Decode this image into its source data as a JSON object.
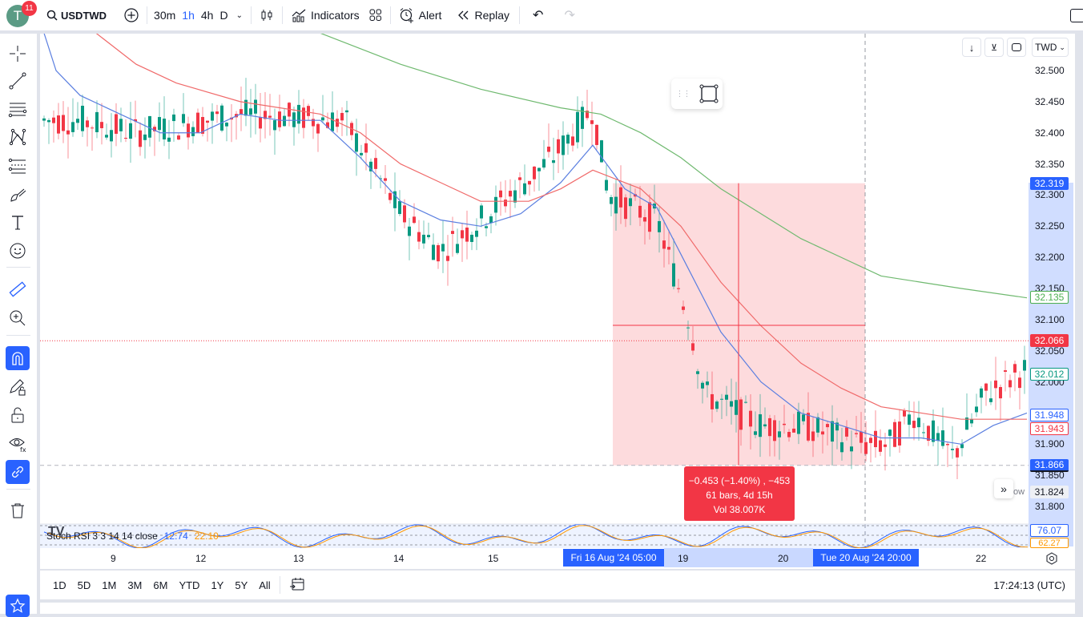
{
  "toolbar": {
    "avatar_letter": "T",
    "notification_count": "11",
    "symbol": "USDTWD",
    "intervals": [
      "30m",
      "1h",
      "4h",
      "D"
    ],
    "active_interval": "1h",
    "indicators_label": "Indicators",
    "alert_label": "Alert",
    "replay_label": "Replay"
  },
  "left_tools": [
    "crosshair",
    "trend-line",
    "horizontal-lines",
    "pattern",
    "fib",
    "brush",
    "text",
    "emoji",
    "ruler",
    "zoom-in",
    "magnet",
    "lock-drawing",
    "lock",
    "visibility",
    "link",
    "trash"
  ],
  "chart": {
    "currency": "TWD",
    "price_labels": [
      "32.500",
      "32.450",
      "32.400",
      "32.350",
      "32.300",
      "32.250",
      "32.200",
      "32.150",
      "32.100",
      "32.050",
      "32.000",
      "31.900",
      "31.850",
      "31.800"
    ],
    "tags": {
      "range_high": {
        "value": "32.319",
        "color": "#2962ff"
      },
      "ma_green": {
        "value": "32.135",
        "color": "#4caf50"
      },
      "line_red": {
        "value": "32.066",
        "color": "#f23645"
      },
      "last_green": {
        "value": "32.012",
        "color": "#089981"
      },
      "ma_blue": {
        "value": "31.948",
        "color": "#2962ff"
      },
      "ma_red": {
        "value": "31.943",
        "color": "#f23645"
      },
      "range_low": {
        "value": "31.866",
        "color": "#2962ff"
      },
      "extra": {
        "value": "31.824"
      }
    },
    "measure": {
      "line1": "−0.453 (−1.40%) , −453",
      "line2": "61 bars, 4d 15h",
      "line3": "Vol 38.007K"
    },
    "overlay_partial_text": "ow",
    "time_labels": [
      "9",
      "12",
      "13",
      "14",
      "15",
      "19",
      "20",
      "22"
    ],
    "time_highlight_start": "Fri 16 Aug '24   05:00",
    "time_highlight_end": "Tue 20 Aug '24   20:00",
    "indicator": {
      "name": "Stoch RSI 3 3 14 14 close",
      "k_value": "12.74",
      "d_value": "22.10",
      "k_tag": "76.07",
      "d_tag": "62.27"
    }
  },
  "bottom": {
    "ranges": [
      "1D",
      "5D",
      "1M",
      "3M",
      "6M",
      "YTD",
      "1Y",
      "5Y",
      "All"
    ],
    "clock": "17:24:13 (UTC)"
  }
}
